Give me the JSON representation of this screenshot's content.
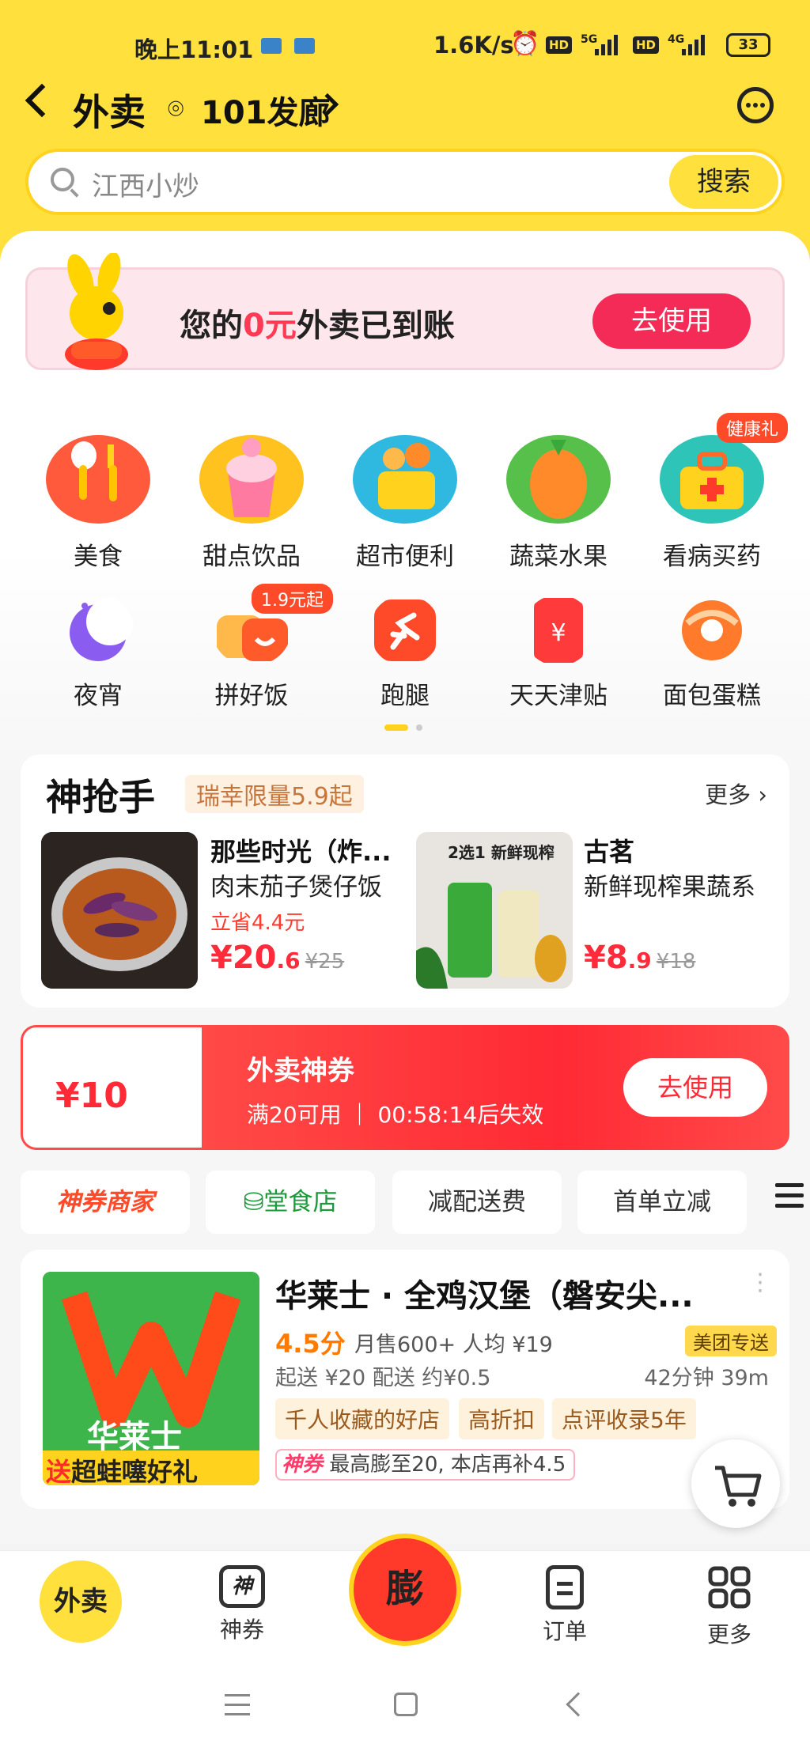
{
  "status": {
    "time": "晚上11:01",
    "speed": "1.6K/s",
    "battery": "33",
    "net1": "5G",
    "net2": "4G",
    "hd": "HD"
  },
  "nav": {
    "title": "外卖",
    "address": "101发廊"
  },
  "search": {
    "placeholder": "江西小炒",
    "button": "搜索"
  },
  "promo": {
    "text_before": "您的",
    "text_highlight": "0元",
    "text_after": "外卖已到账",
    "button": "去使用"
  },
  "categories_row1": [
    {
      "label": "美食",
      "icon": "food-icon"
    },
    {
      "label": "甜点饮品",
      "icon": "dessert-icon"
    },
    {
      "label": "超市便利",
      "icon": "supermarket-icon"
    },
    {
      "label": "蔬菜水果",
      "icon": "vegetable-icon"
    },
    {
      "label": "看病买药",
      "icon": "medicine-icon",
      "badge": "健康礼"
    }
  ],
  "categories_row2": [
    {
      "label": "夜宵",
      "icon": "moon-icon"
    },
    {
      "label": "拼好饭",
      "icon": "group-meal-icon",
      "badge": "1.9元起"
    },
    {
      "label": "跑腿",
      "icon": "errand-icon"
    },
    {
      "label": "天天津贴",
      "icon": "subsidy-icon"
    },
    {
      "label": "面包蛋糕",
      "icon": "donut-icon"
    }
  ],
  "deals": {
    "title": "神抢手",
    "tag": "瑞幸限量5.9起",
    "more": "更多",
    "items": [
      {
        "name": "那些时光（炸...",
        "sub": "肉末茄子煲仔饭",
        "save": "立省4.4元",
        "price_int": "¥20",
        "price_dec": ".6",
        "orig": "¥25"
      },
      {
        "name": "古茗",
        "sub": "新鲜现榨果蔬系",
        "price_int": "¥8",
        "price_dec": ".9",
        "orig": "¥18",
        "img_text1": "2选1",
        "img_text2": "新鲜现榨"
      }
    ]
  },
  "coupon": {
    "symbol": "¥",
    "amount": "10",
    "title": "外卖神券",
    "condition": "满20可用",
    "timer": "00:58:14后失效",
    "button": "去使用"
  },
  "filters": [
    "神券商家",
    "堂食店",
    "减配送费",
    "首单立减"
  ],
  "shop": {
    "name": "华莱士 · 全鸡汉堡（磐安尖...",
    "rating": "4.5分",
    "sales": "月售600+  人均 ¥19",
    "badge": "美团专送",
    "delivery": "起送 ¥20  配送 约¥0.5",
    "time": "42分钟  39m",
    "chips": [
      "千人收藏的好店",
      "高折扣",
      "点评收录5年"
    ],
    "boost_tag": "神券",
    "boost_text": "最高膨至20, 本店再补4.5",
    "img_brand": "华莱士",
    "img_slogan_a": "送",
    "img_slogan_b": "超蛙噻好礼"
  },
  "tabbar": {
    "home": "外卖",
    "coupon": "神券",
    "center": "膨",
    "orders": "订单",
    "more": "更多"
  },
  "colors": {
    "brand": "#ffe03c",
    "accent": "#ff2a35",
    "pink": "#f32b56"
  }
}
